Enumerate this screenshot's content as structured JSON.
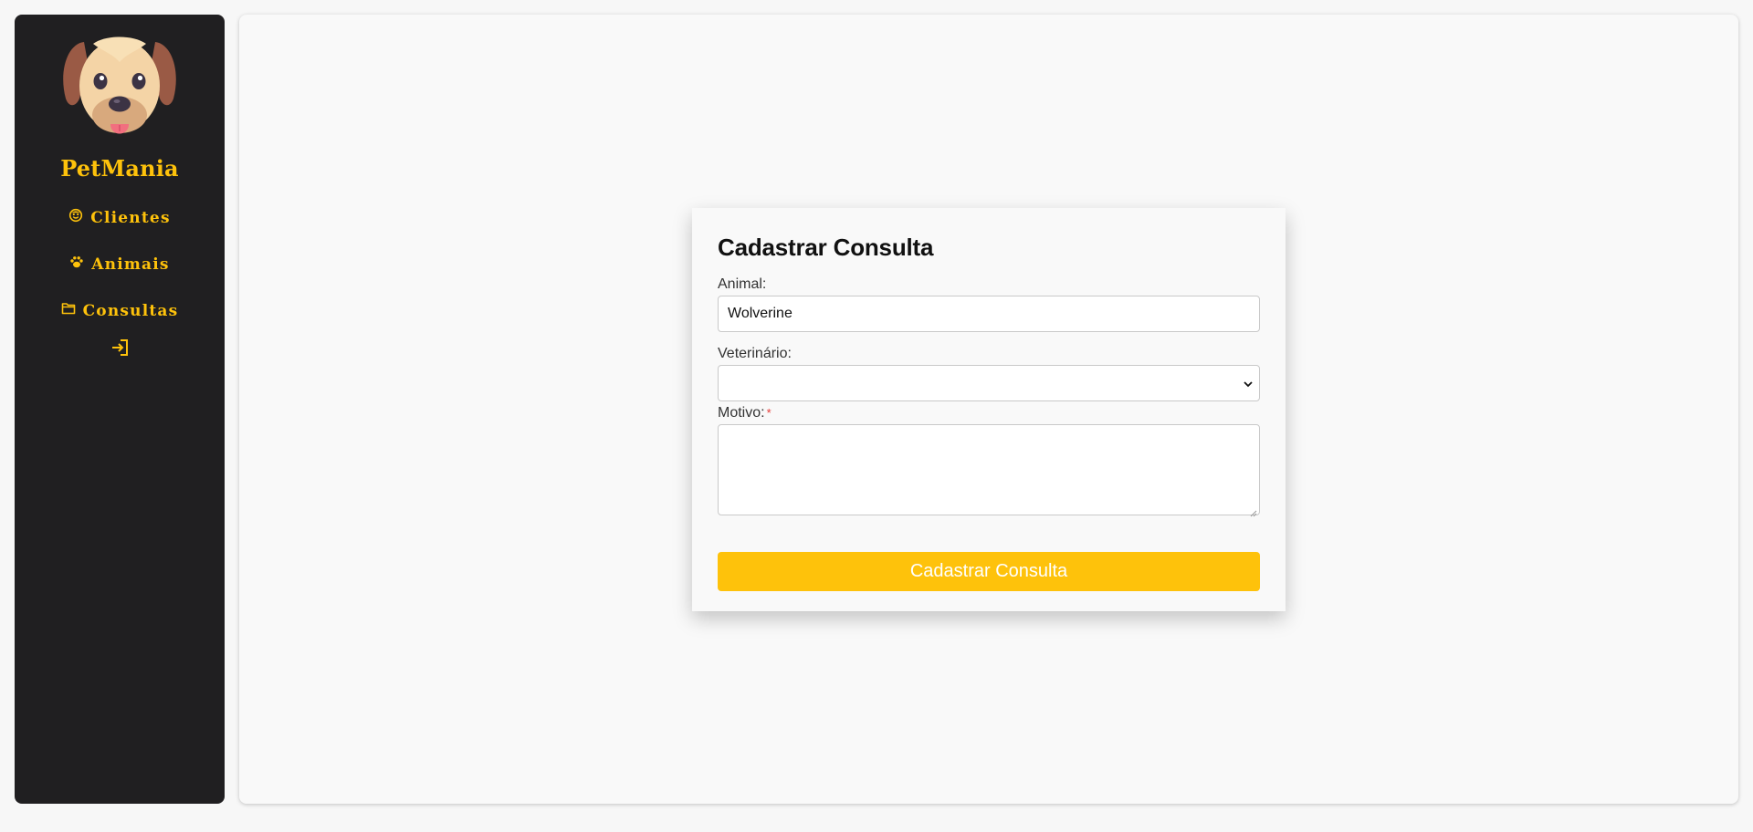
{
  "app": {
    "brand": "PetMania",
    "logo_icon": "dog-face-icon",
    "accent_color": "#fec20b",
    "sidebar_bg": "#201f21"
  },
  "nav": {
    "items": [
      {
        "label": "Clientes",
        "icon": "face-icon"
      },
      {
        "label": "Animais",
        "icon": "paw-icon"
      },
      {
        "label": "Consultas",
        "icon": "folder-icon"
      }
    ],
    "logout_icon": "logout-icon"
  },
  "form": {
    "title": "Cadastrar Consulta",
    "animal_label": "Animal:",
    "animal_value": "Wolverine",
    "vet_label": "Veterinário:",
    "vet_value": "",
    "motivo_label": "Motivo:",
    "motivo_required_mark": "*",
    "motivo_value": "",
    "submit_label": "Cadastrar Consulta"
  }
}
